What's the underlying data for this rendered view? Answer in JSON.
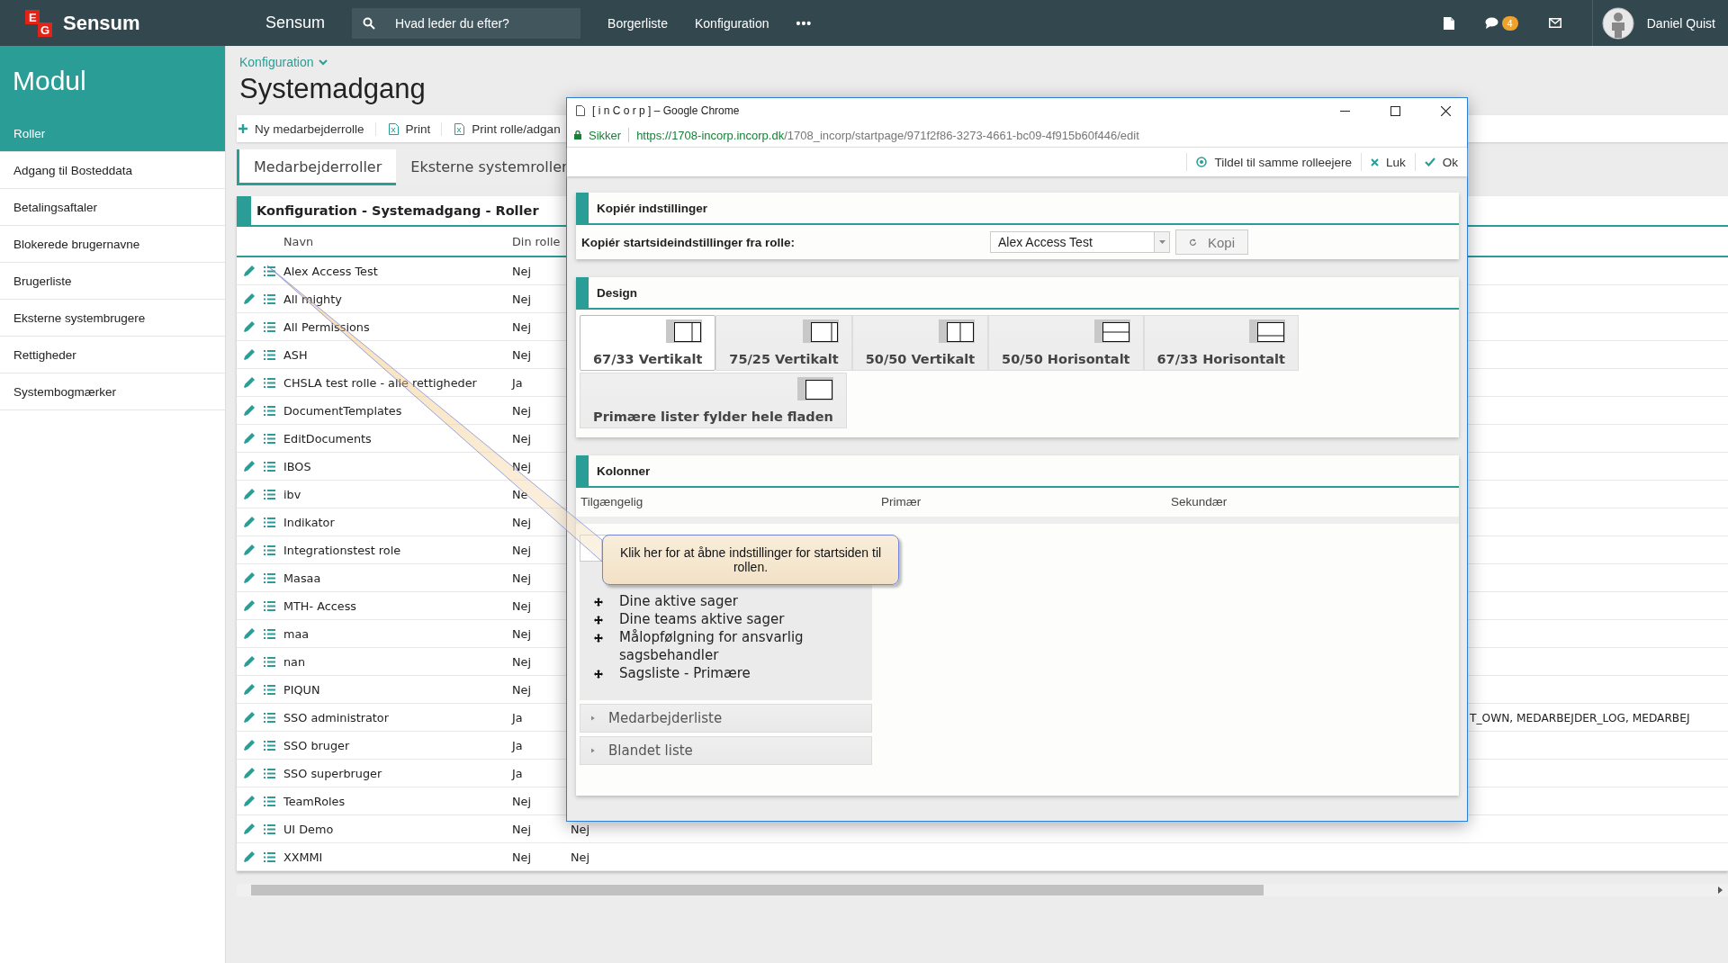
{
  "topbar": {
    "logo_letters": [
      "E",
      "G"
    ],
    "brand": "Sensum",
    "app_title": "Sensum",
    "search": {
      "placeholder": "Hvad leder du efter?"
    },
    "nav": [
      "Borgerliste",
      "Konfiguration"
    ],
    "more": "•••",
    "chat_badge": "4",
    "user": "Daniel Quist"
  },
  "sidebar": {
    "title": "Modul",
    "items": [
      {
        "label": "Roller",
        "selected": true
      },
      {
        "label": "Adgang til Bosteddata",
        "selected": false
      },
      {
        "label": "Betalingsaftaler",
        "selected": false
      },
      {
        "label": "Blokerede brugernavne",
        "selected": false
      },
      {
        "label": "Brugerliste",
        "selected": false
      },
      {
        "label": "Eksterne systembrugere",
        "selected": false
      },
      {
        "label": "Rettigheder",
        "selected": false
      },
      {
        "label": "Systembogmærker",
        "selected": false
      }
    ]
  },
  "page": {
    "breadcrumb": "Konfiguration",
    "title": "Systemadgang",
    "toolbar": [
      {
        "label": "Ny medarbejderrolle",
        "kind": "add"
      },
      {
        "label": "Print",
        "kind": "export"
      },
      {
        "label": "Print rolle/adgan",
        "kind": "export"
      }
    ],
    "tabs": [
      {
        "label": "Medarbejderroller",
        "selected": true
      },
      {
        "label": "Eksterne systemroller",
        "selected": false
      }
    ],
    "table": {
      "title": "Konfiguration - Systemadgang - Roller",
      "columns": [
        "Navn",
        "Din rolle"
      ],
      "rows": [
        {
          "name": "Alex Access Test",
          "own_role": "Nej"
        },
        {
          "name": "All mighty",
          "own_role": "Nej"
        },
        {
          "name": "All Permissions",
          "own_role": "Nej"
        },
        {
          "name": "ASH",
          "own_role": "Nej"
        },
        {
          "name": "CHSLA test rolle - alle rettigheder",
          "own_role": "Ja"
        },
        {
          "name": "DocumentTemplates",
          "own_role": "Nej"
        },
        {
          "name": "EditDocuments",
          "own_role": "Nej"
        },
        {
          "name": "IBOS",
          "own_role": "Nej"
        },
        {
          "name": "ibv",
          "own_role": "Ne"
        },
        {
          "name": "Indikator",
          "own_role": "Nej"
        },
        {
          "name": "Integrationstest role",
          "own_role": "Nej"
        },
        {
          "name": "Masaa",
          "own_role": "Nej"
        },
        {
          "name": "MTH- Access",
          "own_role": "Nej"
        },
        {
          "name": "maa",
          "own_role": "Nej"
        },
        {
          "name": "nan",
          "own_role": "Nej"
        },
        {
          "name": "PIQUN",
          "own_role": "Nej"
        },
        {
          "name": "SSO administrator",
          "own_role": "Ja",
          "column_4": "T_OWN, MEDARBEJDER_LOG, MEDARBEJ"
        },
        {
          "name": "SSO bruger",
          "own_role": "Ja"
        },
        {
          "name": "SSO superbruger",
          "own_role": "Ja"
        },
        {
          "name": "TeamRoles",
          "own_role": "Nej"
        },
        {
          "name": "UI Demo",
          "own_role": "Nej",
          "column_3": "Nej"
        },
        {
          "name": "XXMMI",
          "own_role": "Nej",
          "column_3": "Nej"
        }
      ]
    }
  },
  "popup": {
    "title": "[ i n C o r p ] – Google Chrome",
    "security": "Sikker",
    "url_host": "https://1708-incorp.incorp.dk",
    "url_path": "/1708_incorp/startpage/971f2f86-3273-4661-bc09-4f915b60f446/edit",
    "actions": [
      {
        "label": "Tildel til samme rolleejere",
        "kind": "assign"
      },
      {
        "label": "Luk",
        "kind": "close"
      },
      {
        "label": "Ok",
        "kind": "ok"
      }
    ],
    "copy_panel": {
      "title": "Kopiér indstillinger",
      "label": "Kopiér startsideindstillinger fra rolle:",
      "select_value": "Alex Access Test",
      "button": {
        "label": "Kopi",
        "disabled": true
      }
    },
    "design_panel": {
      "title": "Design",
      "options": [
        {
          "label": "67/33 Vertikalt",
          "kind": "v67",
          "selected": true
        },
        {
          "label": "75/25 Vertikalt",
          "kind": "v75",
          "selected": false
        },
        {
          "label": "50/50 Vertikalt",
          "kind": "v50",
          "selected": false
        },
        {
          "label": "50/50 Horisontalt",
          "kind": "h50",
          "selected": false
        },
        {
          "label": "67/33 Horisontalt",
          "kind": "h67",
          "selected": false
        },
        {
          "label": "Primære lister fylder hele fladen",
          "kind": "full",
          "selected": false
        }
      ]
    },
    "columns_panel": {
      "title": "Kolonner",
      "headers": [
        "Tilgængelig",
        "Primær",
        "Sekundær"
      ],
      "available": [
        "Dine aktive sager",
        "Dine teams aktive sager",
        "Målopfølgning for ansvarlig sagsbehandler",
        "Sagsliste - Primære"
      ],
      "groups": [
        {
          "label": "Medarbejderliste",
          "expanded": false
        },
        {
          "label": "Blandet liste",
          "expanded": false
        }
      ]
    }
  },
  "tooltip": {
    "text": "Klik her for at åbne indstillinger for startsiden til rollen."
  }
}
